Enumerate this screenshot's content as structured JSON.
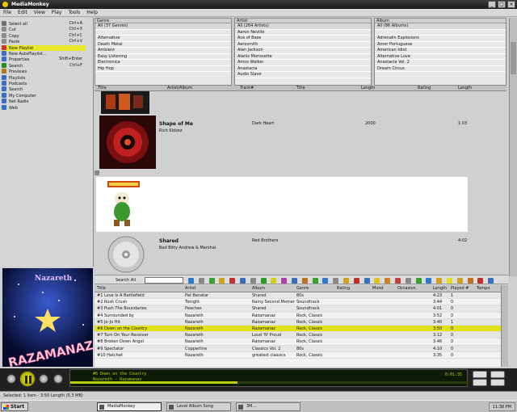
{
  "window": {
    "title": "MediaMonkey"
  },
  "menu": [
    "File",
    "Edit",
    "View",
    "Play",
    "Tools",
    "Help"
  ],
  "left_tree": [
    {
      "label": "Select all",
      "extra": "Ctrl+A",
      "color": "#6f6f6f"
    },
    {
      "label": "Cut",
      "extra": "Ctrl+X",
      "color": "#8a8a8a"
    },
    {
      "label": "Copy",
      "extra": "Ctrl+C",
      "color": "#8a8a8a"
    },
    {
      "label": "Paste",
      "extra": "Ctrl+V",
      "color": "#8a8a8a"
    },
    {
      "label": "New Playlist",
      "extra": "",
      "color": "#c33",
      "selected": true
    },
    {
      "label": "New AutoPlaylist...",
      "extra": "",
      "color": "#3a6fc0"
    },
    {
      "label": "Properties",
      "extra": "Shift+Enter",
      "color": "#3a6fc0"
    },
    {
      "label": "Search",
      "extra": "Ctrl+F",
      "color": "#2a8a2a"
    },
    {
      "label": "Previews",
      "extra": "",
      "color": "#aa7a20"
    },
    {
      "label": "Playlists",
      "extra": "",
      "color": "#3a6fc0"
    },
    {
      "label": "Podcasts",
      "extra": "",
      "color": "#3a6fc0"
    },
    {
      "label": "Search",
      "extra": "",
      "color": "#3a6fc0"
    },
    {
      "label": "My Computer",
      "extra": "",
      "color": "#3a6fc0"
    },
    {
      "label": "Net Radio",
      "extra": "",
      "color": "#3a6fc0"
    },
    {
      "label": "Web",
      "extra": "",
      "color": "#3a6fc0"
    }
  ],
  "browser": {
    "columns": [
      {
        "header": "Genre",
        "items": [
          "All (37 Genres)",
          "",
          "Alternative",
          "Death Metal",
          "Ambient",
          "Easy Listening",
          "Electronica",
          "Hip Hop"
        ]
      },
      {
        "header": "Artist",
        "items": [
          "All (264 Artists)",
          "Aaron Neville",
          "Ace of Base",
          "Aerosmith",
          "Alan Jackson",
          "Alanis Morissette",
          "Amos Walker",
          "Anastacia",
          "Audio Slave"
        ]
      },
      {
        "header": "Album",
        "items": [
          "All (86 Albums)",
          "",
          "Adrenalin Explosions",
          "Amor Portuguese",
          "American Idiot",
          "Alternative Love",
          "Anastacia Vol. 2",
          "Dream Circus"
        ]
      }
    ]
  },
  "album_header": {
    "col_a": "Title",
    "col_b": "Artist/Album",
    "col_c": "Track#",
    "col_d": "Title",
    "col_e": "Length",
    "col_f": "Rating",
    "col_g": "Length"
  },
  "albums": [
    {
      "title": "Shape of Me",
      "sub": "Rich Kidzez",
      "track": "Dark Heart",
      "year": "2000",
      "len": "1:03"
    },
    {
      "title": "Shared",
      "sub": "Bad Bitty Andrew & Marshal",
      "track": "Red Brothers",
      "year": "",
      "len": "4:02"
    }
  ],
  "toolbar": {
    "search_label": "Search All"
  },
  "tracklist": {
    "headers": [
      "Title",
      "Artist",
      "Album",
      "Genre",
      "Rating",
      "Mood",
      "Occasion",
      "Length",
      "Played #",
      "Tempo"
    ],
    "rows": [
      [
        "#1 Love Is A Battlefield",
        "Pat Benatar",
        "Shared",
        "80s",
        "",
        "",
        "",
        "4:23",
        "1",
        ""
      ],
      [
        "#2 Rush Crush",
        "Tonight",
        "Rainy Second Moment",
        "Soundtrack",
        "",
        "",
        "",
        "3:44",
        "0",
        ""
      ],
      [
        "#3 Push The Boundaries",
        "Peaches",
        "Shared",
        "Soundtrack",
        "",
        "",
        "",
        "4:01",
        "0",
        ""
      ],
      [
        "#4 Surrounded by",
        "Nazareth",
        "Razamanaz",
        "Rock, Classic",
        "",
        "",
        "",
        "3:52",
        "0",
        ""
      ],
      [
        "#5 Jo-Jo Hit",
        "Nazareth",
        "Razamanaz",
        "Rock, Classic",
        "",
        "",
        "",
        "3:40",
        "1",
        ""
      ],
      [
        "#6 Down on the Country",
        "Nazareth",
        "Razamanaz",
        "Rock, Classic",
        "",
        "",
        "",
        "3:50",
        "0",
        ""
      ],
      [
        "#7 Turn On Your Receiver",
        "Nazareth",
        "Loud 'N' Proud",
        "Rock, Classic",
        "",
        "",
        "",
        "3:12",
        "0",
        ""
      ],
      [
        "#8 Broken Down Angel",
        "Nazareth",
        "Razamanaz",
        "Rock, Classic",
        "",
        "",
        "",
        "3:46",
        "0",
        ""
      ],
      [
        "#9 Spectator",
        "Copperline",
        "Classics Vol. 2",
        "80s",
        "",
        "",
        "",
        "4:10",
        "0",
        ""
      ],
      [
        "#10 Hatchet",
        "Nazareth",
        "greatest classics",
        "Rock, Classic",
        "",
        "",
        "",
        "3:35",
        "0",
        ""
      ]
    ],
    "playing_index": 5
  },
  "player": {
    "lcd_line1": "#6 Down on the Country",
    "lcd_line2": "Nazareth - Razamanaz",
    "time": "0:01:35",
    "progress": 0.42
  },
  "nowplaying": {
    "band": "Nazareth",
    "album_art_text": "RAZAMANAZ"
  },
  "statusbar": {
    "text": "Selected: 1 item  -  3:50 Length  (5.3 MB)"
  },
  "taskbar": {
    "start": "Start",
    "tasks": [
      "MediaMonkey",
      "Level Album Song",
      "3M..."
    ],
    "clock": "11:38 PM"
  }
}
